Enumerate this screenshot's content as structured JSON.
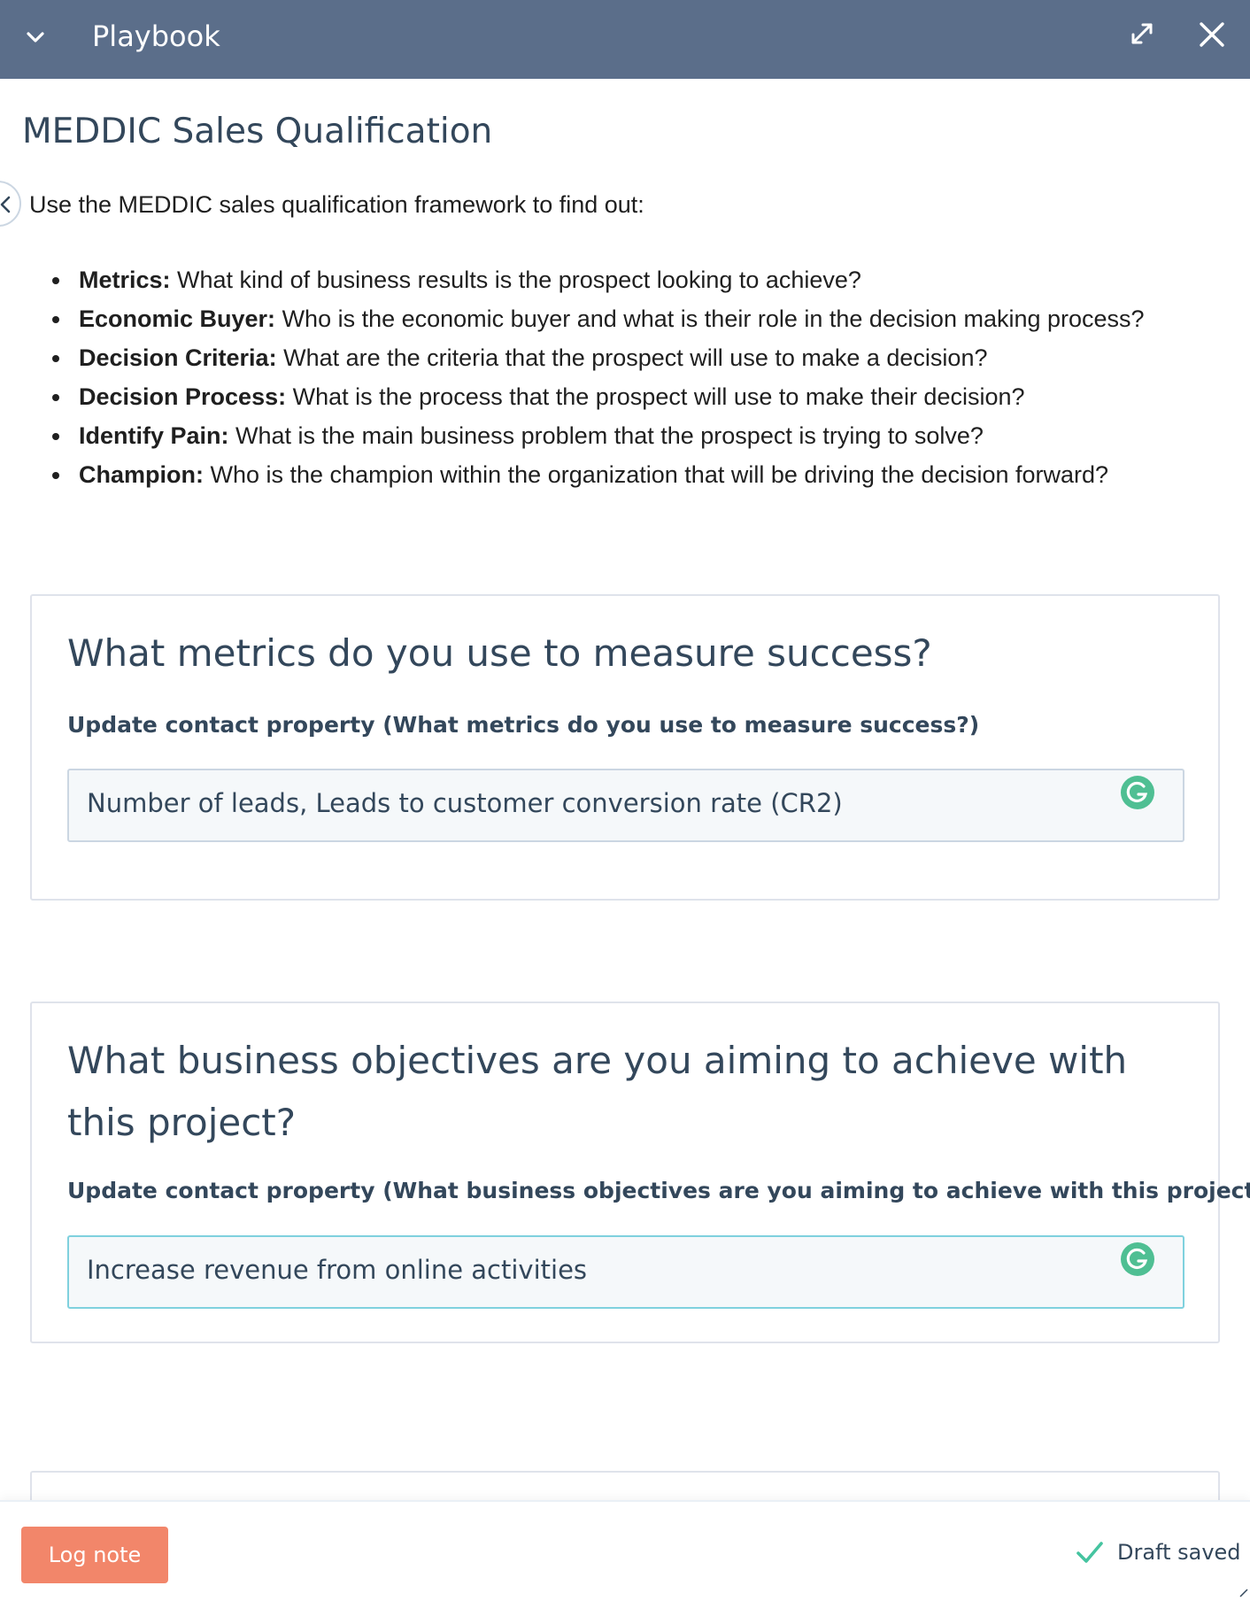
{
  "header": {
    "title": "Playbook",
    "icons": {
      "collapse": "chevron-down-icon",
      "expand": "expand-icon",
      "close": "close-icon"
    }
  },
  "playbook": {
    "title": "MEDDIC Sales Qualification",
    "intro": "Use the MEDDIC sales qualification framework to find out:",
    "bullets": [
      {
        "term": "Metrics:",
        "text": " What kind of business results is the prospect looking to achieve?"
      },
      {
        "term": "Economic Buyer:",
        "text": " Who is the economic buyer and what is their role in the decision making process?"
      },
      {
        "term": "Decision Criteria:",
        "text": " What are the criteria that the prospect will use to make a decision?"
      },
      {
        "term": "Decision Process:",
        "text": " What is the process that the prospect will use to make their decision?"
      },
      {
        "term": "Identify Pain:",
        "text": " What is the main business problem that the prospect is trying to solve?"
      },
      {
        "term": "Champion:",
        "text": " Who is the champion within the organization that will be driving the decision forward?"
      }
    ]
  },
  "questions": [
    {
      "question": "What metrics do you use to measure success?",
      "property_label": "Update contact property (What metrics do you use to measure success?)",
      "value": "Number of leads, Leads to customer conversion rate (CR2)"
    },
    {
      "question": "What business objectives are you aiming to achieve with this project?",
      "property_label": "Update contact property (What business objectives are you aiming to achieve with this project? )",
      "value": "Increase revenue from online activities"
    }
  ],
  "footer": {
    "log_note_label": "Log note",
    "draft_status": "Draft saved"
  },
  "colors": {
    "header_bg": "#5b6e8a",
    "accent_button": "#f2866a",
    "success_check": "#45c4a0",
    "grammarly": "#4fbf93",
    "text": "#33475b"
  }
}
